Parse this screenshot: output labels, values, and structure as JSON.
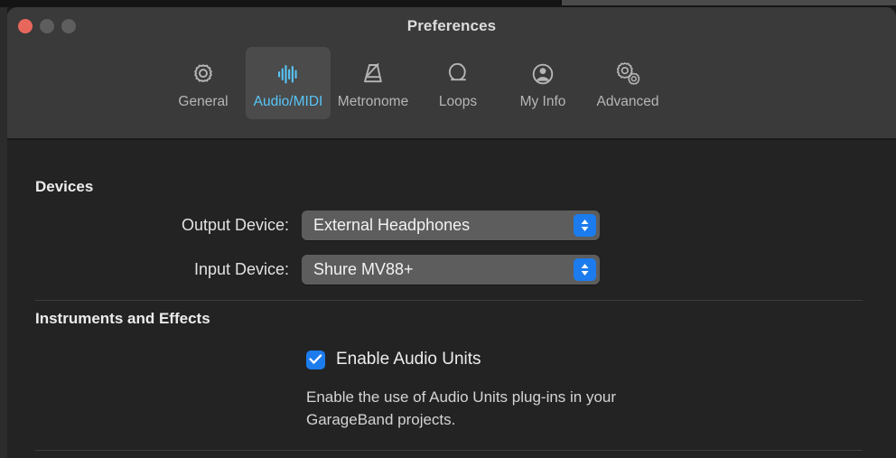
{
  "window": {
    "title": "Preferences",
    "traffic_lights": [
      {
        "name": "close",
        "color": "#e8675c"
      },
      {
        "name": "minimize",
        "color": "#5e5e5e"
      },
      {
        "name": "maximize",
        "color": "#5e5e5e"
      }
    ]
  },
  "toolbar": {
    "tabs": [
      {
        "label": "General",
        "icon": "gear-icon",
        "selected": false
      },
      {
        "label": "Audio/MIDI",
        "icon": "waveform-icon",
        "selected": true
      },
      {
        "label": "Metronome",
        "icon": "metronome-icon",
        "selected": false
      },
      {
        "label": "Loops",
        "icon": "loop-icon",
        "selected": false
      },
      {
        "label": "My Info",
        "icon": "person-icon",
        "selected": false
      },
      {
        "label": "Advanced",
        "icon": "gears-icon",
        "selected": false
      }
    ],
    "selected_tab": "Audio/MIDI",
    "accent_color": "#57c5f7"
  },
  "content": {
    "devices": {
      "title": "Devices",
      "output": {
        "label": "Output Device:",
        "value": "External Headphones"
      },
      "input": {
        "label": "Input Device:",
        "value": "Shure MV88+"
      }
    },
    "instruments_and_effects": {
      "title": "Instruments and Effects",
      "audio_units": {
        "label": "Enable Audio Units",
        "checked": true,
        "help_text": "Enable the use of Audio Units plug-ins in your GarageBand projects."
      }
    }
  },
  "colors": {
    "titlebar": "#3a3a3a",
    "content_bg": "#232323",
    "control_blue": "#1c7ced",
    "popup_gray": "#5d5d5d",
    "divider": "#3c3c3c"
  }
}
